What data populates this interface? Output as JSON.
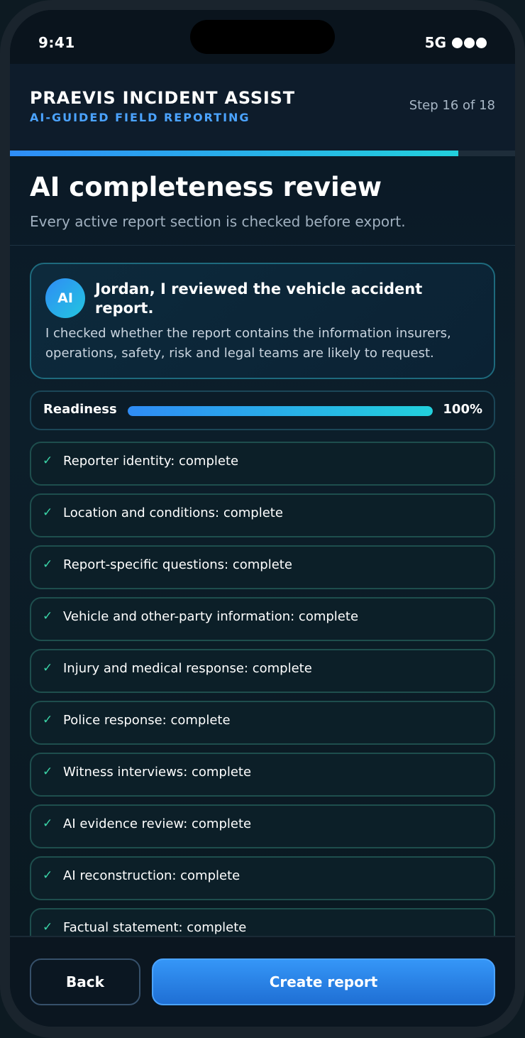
{
  "status_bar": {
    "time": "9:41",
    "network": "5G"
  },
  "header": {
    "title": "PRAEVIS INCIDENT ASSIST",
    "subtitle": "AI-GUIDED FIELD REPORTING",
    "step": "Step 16 of 18",
    "progress_fraction": 0.888
  },
  "page": {
    "title": "AI completeness review",
    "subtitle": "Every active report section is checked before export."
  },
  "ai_card": {
    "avatar": "AI",
    "heading": "Jordan, I reviewed the vehicle accident report.",
    "body": "I checked whether the report contains the information insurers, operations, safety, risk and legal teams are likely to request."
  },
  "readiness": {
    "label": "Readiness",
    "value": "100%",
    "fraction": 1.0
  },
  "checks": [
    {
      "icon": "check-icon",
      "mark": "✓",
      "text": "Reporter identity: complete"
    },
    {
      "icon": "check-icon",
      "mark": "✓",
      "text": "Location and conditions: complete"
    },
    {
      "icon": "check-icon",
      "mark": "✓",
      "text": "Report-specific questions: complete"
    },
    {
      "icon": "check-icon",
      "mark": "✓",
      "text": "Vehicle and other-party information: complete"
    },
    {
      "icon": "check-icon",
      "mark": "✓",
      "text": "Injury and medical response: complete"
    },
    {
      "icon": "check-icon",
      "mark": "✓",
      "text": "Police response: complete"
    },
    {
      "icon": "check-icon",
      "mark": "✓",
      "text": "Witness interviews: complete"
    },
    {
      "icon": "check-icon",
      "mark": "✓",
      "text": "AI evidence review: complete"
    },
    {
      "icon": "check-icon",
      "mark": "✓",
      "text": "AI reconstruction: complete"
    },
    {
      "icon": "check-icon",
      "mark": "✓",
      "text": "Factual statement: complete"
    }
  ],
  "footer": {
    "back_label": "Back",
    "create_label": "Create report"
  },
  "colors": {
    "accent": "#2e8df7",
    "accent_2": "#22d0dc",
    "check": "#3bd5a8",
    "brand_sub": "#4ba3ff"
  }
}
